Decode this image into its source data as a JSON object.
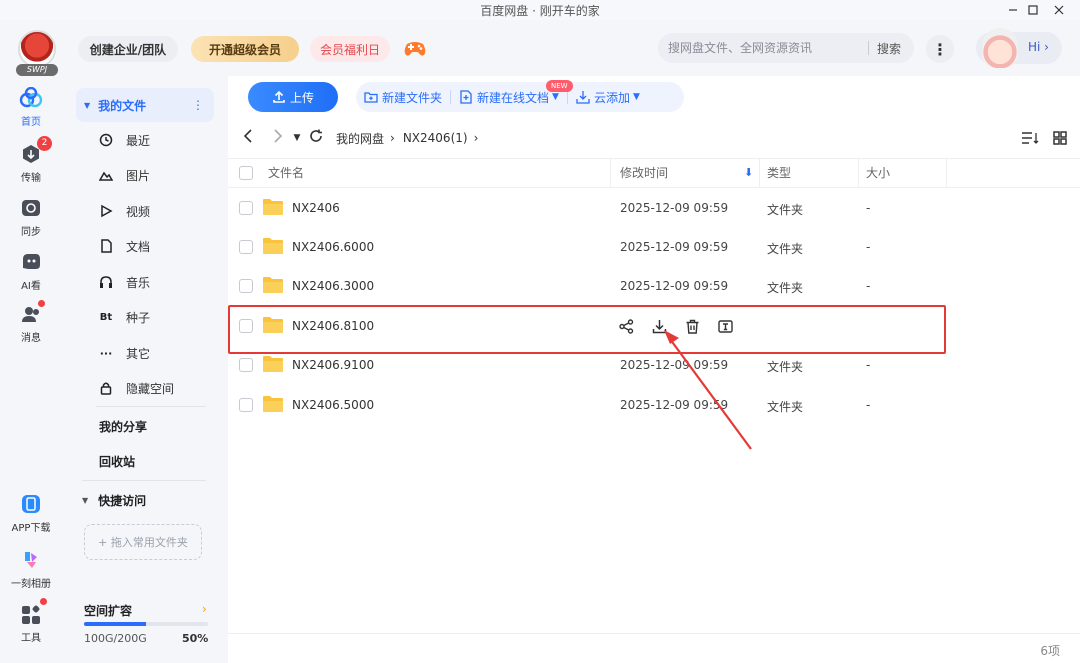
{
  "window": {
    "title": "百度网盘 · 刚开车的家",
    "controls": [
      "minimize",
      "maximize",
      "close"
    ]
  },
  "header": {
    "logo_tag": "SWPJ",
    "team_button": "创建企业/团队",
    "vip_button": "开通超级会员",
    "fuli_button": "会员福利日",
    "search_placeholder": "搜网盘文件、全网资源资讯",
    "search_button": "搜索",
    "hi_label": "Hi ›"
  },
  "rail": [
    {
      "label": "首页",
      "icon": "home-icon",
      "active": true
    },
    {
      "label": "传输",
      "icon": "transfer-icon",
      "badge": "2"
    },
    {
      "label": "同步",
      "icon": "sync-icon"
    },
    {
      "label": "AI看",
      "icon": "ai-icon"
    },
    {
      "label": "消息",
      "icon": "message-icon",
      "dot": true
    },
    {
      "label": "APP下载",
      "icon": "app-download-icon"
    },
    {
      "label": "一刻相册",
      "icon": "album-icon"
    },
    {
      "label": "工具",
      "icon": "tools-icon",
      "dot": true
    }
  ],
  "nav": {
    "root_label": "我的文件",
    "items": [
      "最近",
      "图片",
      "视频",
      "文档",
      "音乐",
      "种子",
      "其它",
      "隐藏空间"
    ],
    "my_share": "我的分享",
    "recycle": "回收站",
    "quick_access": "快捷访问",
    "drop_hint": "+ 拖入常用文件夹",
    "storage_title": "空间扩容",
    "storage_used": "100G/200G",
    "storage_percent": "50%",
    "storage_fraction": 0.5
  },
  "toolbar": {
    "upload": "上传",
    "new_folder": "新建文件夹",
    "new_doc": "新建在线文档",
    "new_tag": "NEW",
    "cloud_add": "云添加"
  },
  "path": {
    "crumbs": [
      "我的网盘",
      "NX2406(1)"
    ]
  },
  "table": {
    "columns": {
      "name": "文件名",
      "modified": "修改时间",
      "type": "类型",
      "size": "大小"
    },
    "rows": [
      {
        "name": "NX2406",
        "modified": "2025-12-09 09:59",
        "type": "文件夹",
        "size": "-"
      },
      {
        "name": "NX2406.6000",
        "modified": "2025-12-09 09:59",
        "type": "文件夹",
        "size": "-"
      },
      {
        "name": "NX2406.3000",
        "modified": "2025-12-09 09:59",
        "type": "文件夹",
        "size": "-"
      },
      {
        "name": "NX2406.8100",
        "modified": "",
        "type": "",
        "size": "",
        "hovered": true
      },
      {
        "name": "NX2406.9100",
        "modified": "2025-12-09 09:59",
        "type": "文件夹",
        "size": "-"
      },
      {
        "name": "NX2406.5000",
        "modified": "2025-12-09 09:59",
        "type": "文件夹",
        "size": "-"
      }
    ],
    "row_actions": [
      "share-icon",
      "download-icon",
      "delete-icon",
      "rename-icon"
    ]
  },
  "footer": {
    "count": "6项"
  },
  "colors": {
    "accent": "#2a6dfb",
    "highlight": "#e53935",
    "folder": "#f9c33c"
  }
}
